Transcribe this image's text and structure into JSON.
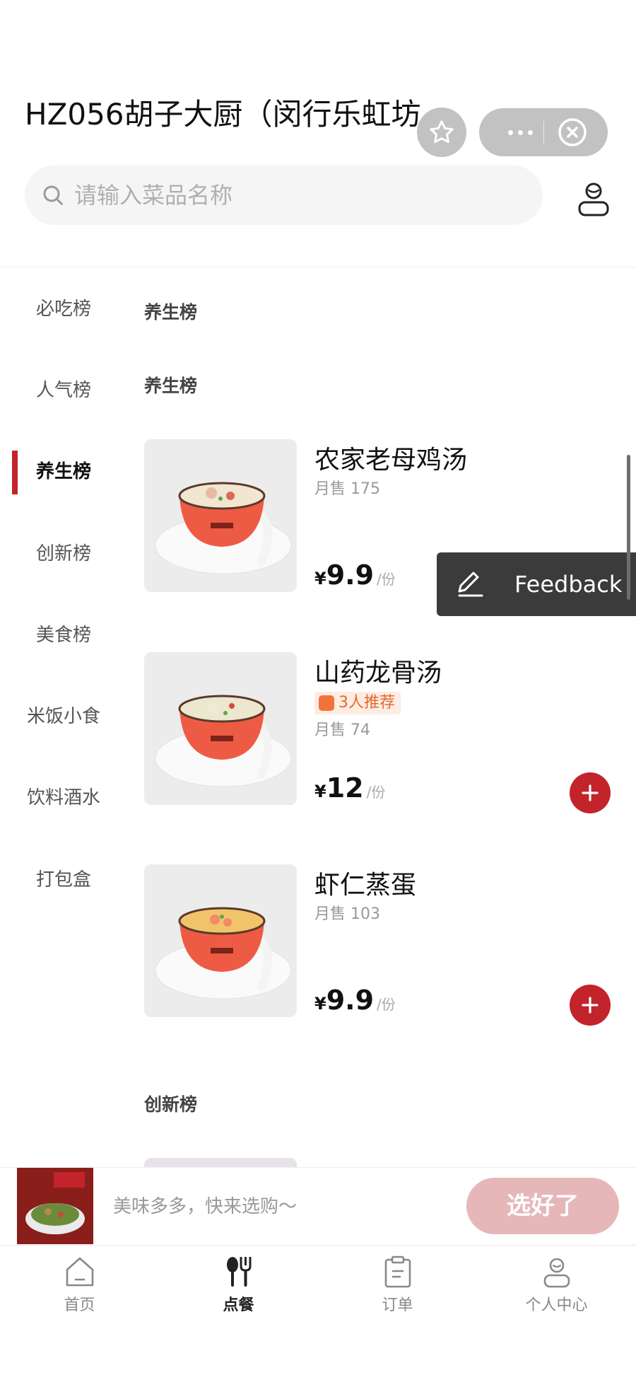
{
  "header": {
    "title": "HZ056胡子大厨（闵行乐虹坊...",
    "search_placeholder": "请输入菜品名称"
  },
  "sidebar": {
    "items": [
      {
        "label": "必吃榜",
        "active": false
      },
      {
        "label": "人气榜",
        "active": false
      },
      {
        "label": "养生榜",
        "active": true
      },
      {
        "label": "创新榜",
        "active": false
      },
      {
        "label": "美食榜",
        "active": false
      },
      {
        "label": "米饭小食",
        "active": false
      },
      {
        "label": "饮料酒水",
        "active": false
      },
      {
        "label": "打包盒",
        "active": false
      }
    ]
  },
  "menu": {
    "section_heading": "养生榜",
    "subsection_heading": "养生榜",
    "next_section_heading": "创新榜",
    "dishes": [
      {
        "name": "农家老母鸡汤",
        "sales": "月售 175",
        "currency": "¥",
        "price": "9.9",
        "unit": "/份",
        "tag": ""
      },
      {
        "name": "山药龙骨汤",
        "sales": "月售 74",
        "currency": "¥",
        "price": "12",
        "unit": "/份",
        "tag": "3人推荐"
      },
      {
        "name": "虾仁蒸蛋",
        "sales": "月售 103",
        "currency": "¥",
        "price": "9.9",
        "unit": "/份",
        "tag": ""
      }
    ]
  },
  "feedback": {
    "label": "Feedback"
  },
  "cart": {
    "hint": "美味多多，快来选购～",
    "checkout_label": "选好了"
  },
  "tabbar": {
    "items": [
      {
        "label": "首页",
        "icon": "home-icon",
        "active": false
      },
      {
        "label": "点餐",
        "icon": "utensils-icon",
        "active": true
      },
      {
        "label": "订单",
        "icon": "clipboard-icon",
        "active": false
      },
      {
        "label": "个人中心",
        "icon": "user-icon",
        "active": false
      }
    ]
  },
  "colors": {
    "accent": "#c3232a",
    "checkout_disabled": "#e6b7b9",
    "tag_bg": "#fdece2",
    "tag_text": "#e46a2c"
  }
}
